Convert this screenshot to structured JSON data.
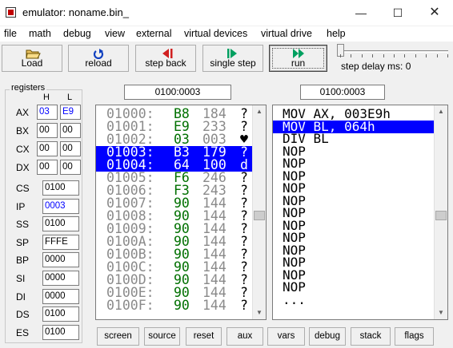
{
  "window": {
    "title": "emulator: noname.bin_",
    "minimize": "—",
    "maximize": "☐",
    "close": "✕"
  },
  "menu": [
    "file",
    "math",
    "debug",
    "view",
    "external",
    "virtual devices",
    "virtual drive",
    "help"
  ],
  "toolbar": {
    "load": "Load",
    "reload": "reload",
    "step_back": "step back",
    "single_step": "single step",
    "run": "run",
    "step_delay_label": "step delay ms: 0",
    "step_delay_ms": 0
  },
  "registers": {
    "title": "registers",
    "h_label": "H",
    "l_label": "L",
    "byte_regs": [
      {
        "name": "AX",
        "h": "03",
        "l": "E9"
      },
      {
        "name": "BX",
        "h": "00",
        "l": "00"
      },
      {
        "name": "CX",
        "h": "00",
        "l": "00"
      },
      {
        "name": "DX",
        "h": "00",
        "l": "00"
      }
    ],
    "word_regs": [
      {
        "name": "CS",
        "value": "0100"
      },
      {
        "name": "IP",
        "value": "0003"
      },
      {
        "name": "SS",
        "value": "0100"
      },
      {
        "name": "SP",
        "value": "FFFE"
      },
      {
        "name": "BP",
        "value": "0000"
      },
      {
        "name": "SI",
        "value": "0000"
      },
      {
        "name": "DI",
        "value": "0000"
      },
      {
        "name": "DS",
        "value": "0100"
      },
      {
        "name": "ES",
        "value": "0100"
      }
    ]
  },
  "memory_address": "0100:0003",
  "disasm_address": "0100:0003",
  "memory": [
    {
      "addr": "01000:",
      "hex": "B8",
      "dec": "184",
      "chr": "?"
    },
    {
      "addr": "01001:",
      "hex": "E9",
      "dec": "233",
      "chr": "?"
    },
    {
      "addr": "01002:",
      "hex": "03",
      "dec": "003",
      "chr": "♥"
    },
    {
      "addr": "01003:",
      "hex": "B3",
      "dec": "179",
      "chr": "?"
    },
    {
      "addr": "01004:",
      "hex": "64",
      "dec": "100",
      "chr": "d"
    },
    {
      "addr": "01005:",
      "hex": "F6",
      "dec": "246",
      "chr": "?"
    },
    {
      "addr": "01006:",
      "hex": "F3",
      "dec": "243",
      "chr": "?"
    },
    {
      "addr": "01007:",
      "hex": "90",
      "dec": "144",
      "chr": "?"
    },
    {
      "addr": "01008:",
      "hex": "90",
      "dec": "144",
      "chr": "?"
    },
    {
      "addr": "01009:",
      "hex": "90",
      "dec": "144",
      "chr": "?"
    },
    {
      "addr": "0100A:",
      "hex": "90",
      "dec": "144",
      "chr": "?"
    },
    {
      "addr": "0100B:",
      "hex": "90",
      "dec": "144",
      "chr": "?"
    },
    {
      "addr": "0100C:",
      "hex": "90",
      "dec": "144",
      "chr": "?"
    },
    {
      "addr": "0100D:",
      "hex": "90",
      "dec": "144",
      "chr": "?"
    },
    {
      "addr": "0100E:",
      "hex": "90",
      "dec": "144",
      "chr": "?"
    },
    {
      "addr": "0100F:",
      "hex": "90",
      "dec": "144",
      "chr": "?"
    }
  ],
  "memory_selected": [
    3,
    4
  ],
  "disassembly": [
    "MOV AX, 003E9h",
    "MOV BL, 064h",
    "DIV BL",
    "NOP",
    "NOP",
    "NOP",
    "NOP",
    "NOP",
    "NOP",
    "NOP",
    "NOP",
    "NOP",
    "NOP",
    "NOP",
    "NOP",
    "..."
  ],
  "disassembly_selected": 1,
  "bottom_buttons": [
    "screen",
    "source",
    "reset",
    "aux",
    "vars",
    "debug",
    "stack",
    "flags"
  ],
  "colors": {
    "selection": "#0000ff",
    "hex_green": "#007000",
    "addr_gray": "#8a8a8a",
    "run_icon": "#00a060",
    "back_icon": "#d02020"
  }
}
